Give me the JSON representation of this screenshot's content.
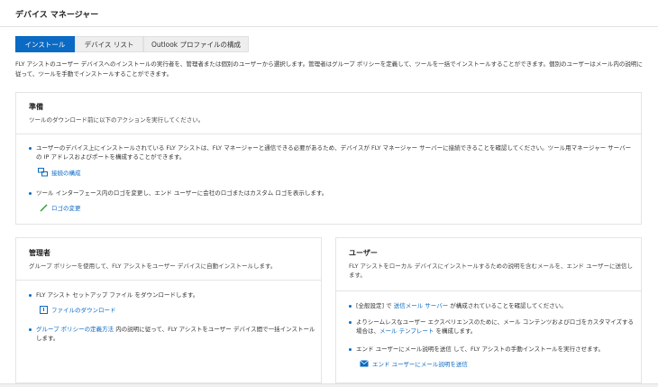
{
  "app": {
    "title": "デバイス マネージャー"
  },
  "tabs": [
    {
      "label": "インストール"
    },
    {
      "label": "デバイス リスト"
    },
    {
      "label": "Outlook プロファイルの構成"
    }
  ],
  "intro": {
    "line1": "FLY アシストのユーザー デバイスへのインストールの実行者を、管理者または個別のユーザーから選択します。管理者はグループ ポリシーを定義して、ツールを一括でインストールすることができます。個別のユーザーはメール内の説明に従って、ツールを手動でインストールすることができます。"
  },
  "prep": {
    "title": "準備",
    "subtitle": "ツールのダウンロード前に以下のアクションを実行してください。",
    "bullet1": "ユーザーのデバイス上にインストールされている FLY アシストは、FLY マネージャーと通信できる必要があるため、デバイスが FLY マネージャー サーバーに接続できることを確認してください。ツール用マネージャー サーバーの IP アドレスおよびポートを構成することができます。",
    "action1": "接続の構成",
    "bullet2": "ツール インターフェース内のロゴを変更し、エンド ユーザーに会社のロゴまたはカスタム ロゴを表示します。",
    "action2": "ロゴの変更"
  },
  "admin": {
    "title": "管理者",
    "subtitle": "グループ ポリシーを使用して、FLY アシストをユーザー デバイスに自動インストールします。",
    "bullet1": "FLY アシスト セットアップ ファイル をダウンロードします。",
    "action1": "ファイルのダウンロード",
    "bullet2_link": "グループ ポリシーの定義方法",
    "bullet2_text": " 内の説明に従って、FLY アシストをユーザー デバイス間で一括インストールします。"
  },
  "user": {
    "title": "ユーザー",
    "subtitle": "FLY アシストをローカル デバイスにインストールするための説明を含むメールを、エンド ユーザーに送信します。",
    "bullet1_pre": "[全般設定] で ",
    "bullet1_link": "送信メール サーバー",
    "bullet1_post": " が構成されていることを確認してください。",
    "bullet2_pre": "よりシームレスなユーザー エクスペリエンスのために、メール コンテンツおよびロゴをカスタマイズする場合は、",
    "bullet2_link": "メール テンプレート",
    "bullet2_post": " を構成します。",
    "bullet3": "エンド ユーザーにメール説明を送信 して、FLY アシストの手動インストールを実行させます。",
    "action1": "エンド ユーザーにメール説明を送信"
  },
  "colors": {
    "accent": "#0b6ac3",
    "border": "#e4e4e4",
    "tab_inactive": "#eeeeee"
  }
}
